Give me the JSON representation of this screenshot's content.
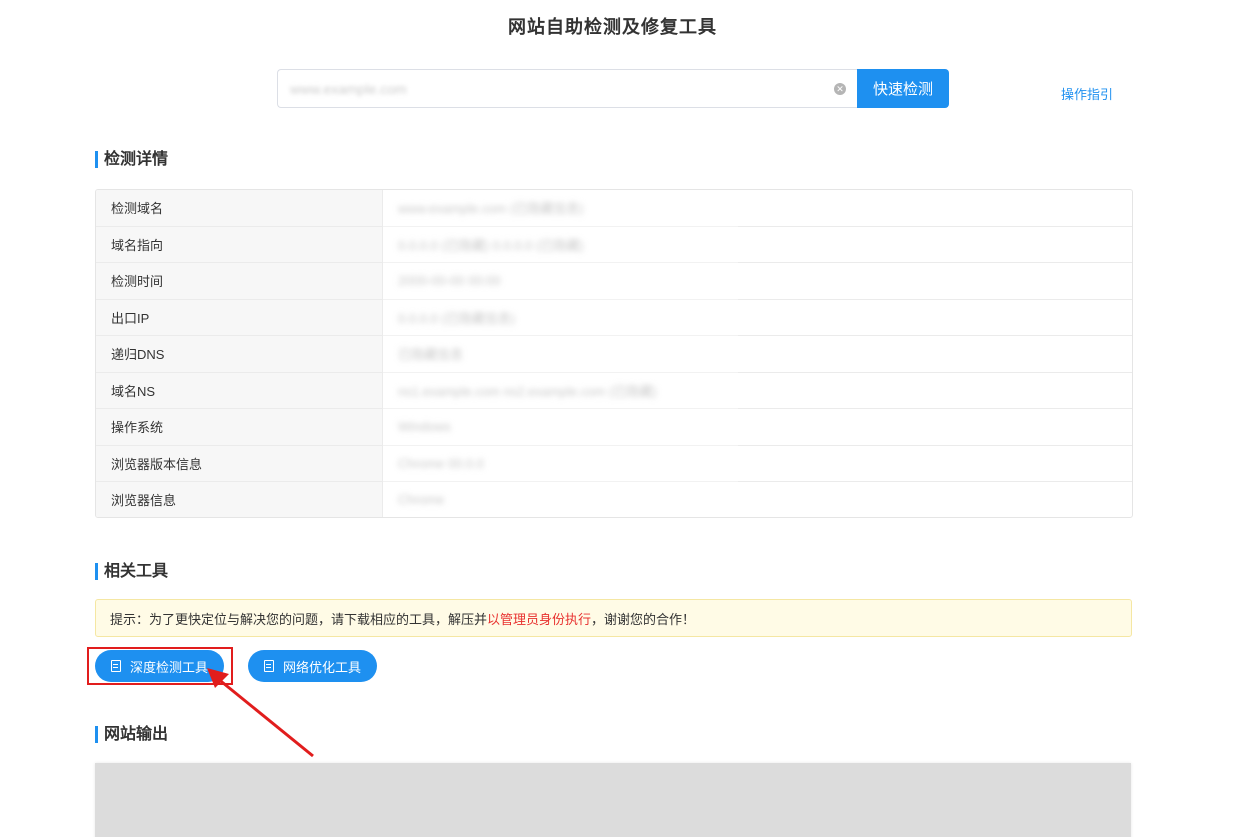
{
  "header": {
    "title": "网站自助检测及修复工具"
  },
  "search": {
    "value": "www.example.com",
    "button_label": "快速检测",
    "guide_link": "操作指引"
  },
  "details": {
    "heading": "检测详情",
    "rows": [
      {
        "key": "检测域名",
        "value": "www.example.com (已隐藏信息)"
      },
      {
        "key": "域名指向",
        "value": "0.0.0.0 (已隐藏) 0.0.0.0 (已隐藏)"
      },
      {
        "key": "检测时间",
        "value": "2000-00-00 00:00"
      },
      {
        "key": "出口IP",
        "value": "0.0.0.0 (已隐藏信息)"
      },
      {
        "key": "递归DNS",
        "value": "已隐藏信息"
      },
      {
        "key": "域名NS",
        "value": "ns1.example.com ns2.example.com (已隐藏)"
      },
      {
        "key": "操作系统",
        "value": "Windows"
      },
      {
        "key": "浏览器版本信息",
        "value": "Chrome 00.0.0"
      },
      {
        "key": "浏览器信息",
        "value": "Chrome"
      }
    ]
  },
  "tools": {
    "heading": "相关工具",
    "tip_prefix": "提示：为了更快定位与解决您的问题，请下载相应的工具，解压并",
    "tip_highlight": "以管理员身份执行",
    "tip_suffix": "，谢谢您的合作！",
    "buttons": [
      {
        "label": "深度检测工具"
      },
      {
        "label": "网络优化工具"
      }
    ]
  },
  "output": {
    "heading": "网站输出"
  },
  "colors": {
    "accent": "#1e90f0",
    "annotation": "#e11d1d",
    "tip_bg": "#fffbe6"
  }
}
